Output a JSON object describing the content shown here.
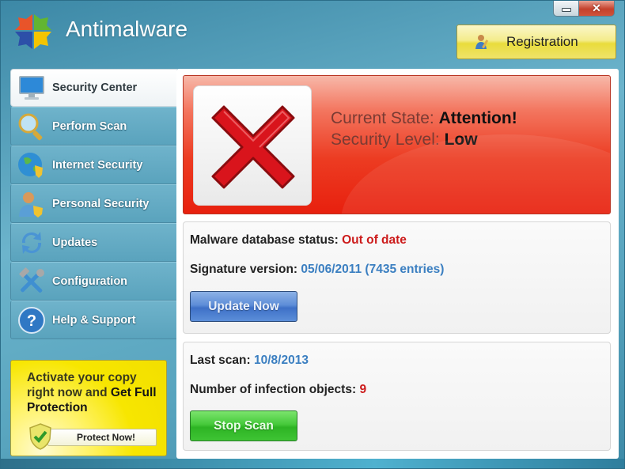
{
  "window": {
    "title": "Antimalware",
    "minimize_label": "",
    "close_label": "✕"
  },
  "header": {
    "registration_label": "Registration"
  },
  "sidebar": {
    "items": [
      {
        "label": "Security Center",
        "icon": "monitor-icon",
        "active": true
      },
      {
        "label": "Perform Scan",
        "icon": "magnifier-icon",
        "active": false
      },
      {
        "label": "Internet Security",
        "icon": "globe-shield-icon",
        "active": false
      },
      {
        "label": "Personal Security",
        "icon": "user-shield-icon",
        "active": false
      },
      {
        "label": "Updates",
        "icon": "refresh-arrows-icon",
        "active": false
      },
      {
        "label": "Configuration",
        "icon": "tools-icon",
        "active": false
      },
      {
        "label": "Help & Support",
        "icon": "question-icon",
        "active": false
      }
    ]
  },
  "promo": {
    "line1": "Activate your copy right now and ",
    "bold": "Get Full Protection",
    "button_label": "Protect Now!"
  },
  "status": {
    "state_label": "Current State: ",
    "state_value": "Attention!",
    "level_label": "Security Level: ",
    "level_value": "Low"
  },
  "database": {
    "status_label": "Malware database status: ",
    "status_value": "Out of date",
    "signature_label": "Signature version: ",
    "signature_value": "05/06/2011 (7435 entries)",
    "update_button": "Update Now"
  },
  "scan": {
    "last_scan_label": "Last scan: ",
    "last_scan_value": "10/8/2013",
    "infections_label": "Number of infection objects: ",
    "infections_value": "9",
    "stop_button": "Stop Scan"
  },
  "colors": {
    "alert_red": "#e8200e",
    "value_red": "#cc1b1b",
    "value_blue": "#3b7fc1",
    "promo_yellow": "#f7e600",
    "registration_yellow": "#e9dc3c"
  }
}
